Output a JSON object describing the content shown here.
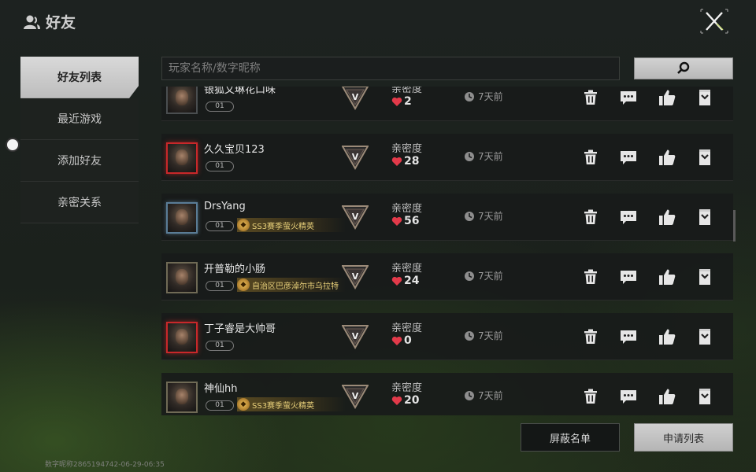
{
  "header": {
    "title": "好友"
  },
  "sidebar": {
    "items": [
      {
        "label": "好友列表",
        "active": true
      },
      {
        "label": "最近游戏",
        "active": false
      },
      {
        "label": "添加好友",
        "active": false
      },
      {
        "label": "亲密关系",
        "active": false
      }
    ]
  },
  "search": {
    "placeholder": "玩家名称/数字昵称",
    "value": ""
  },
  "friends": [
    {
      "name": "银狐文琳花口味",
      "level": "01",
      "title": "",
      "rank": "V",
      "intimacy_label": "亲密度",
      "intimacy": "2",
      "last_seen": "7天前",
      "frame": "dark"
    },
    {
      "name": "久久宝贝123",
      "level": "01",
      "title": "",
      "rank": "V",
      "intimacy_label": "亲密度",
      "intimacy": "28",
      "last_seen": "7天前",
      "frame": "red"
    },
    {
      "name": "DrsYang",
      "level": "01",
      "title": "SS3赛季萤火精英",
      "rank": "V",
      "intimacy_label": "亲密度",
      "intimacy": "56",
      "last_seen": "7天前",
      "frame": "blue"
    },
    {
      "name": "开普勒的小肠",
      "level": "01",
      "title": "自治区巴彦淖尔市乌拉特",
      "rank": "V",
      "intimacy_label": "亲密度",
      "intimacy": "24",
      "last_seen": "7天前",
      "frame": "gold"
    },
    {
      "name": "丁子睿是大帅哥",
      "level": "01",
      "title": "",
      "rank": "V",
      "intimacy_label": "亲密度",
      "intimacy": "0",
      "last_seen": "7天前",
      "frame": "red"
    },
    {
      "name": "神仙hh",
      "level": "01",
      "title": "SS3赛季萤火精英",
      "rank": "V",
      "intimacy_label": "亲密度",
      "intimacy": "20",
      "last_seen": "7天前",
      "frame": "gold"
    }
  ],
  "buttons": {
    "block_list": "屏蔽名单",
    "apply_list": "申请列表"
  },
  "footer": {
    "id_text": "数字昵称2865194742-06-29-06:35"
  },
  "colors": {
    "heart": "#e23a4a",
    "accent_frame_red": "#c8282a",
    "accent_frame_blue": "#5a7c96",
    "title_gold": "#e8d07a"
  },
  "icons": [
    "user-icon",
    "close-icon",
    "search-icon",
    "trash-icon",
    "chat-icon",
    "thumbs-up-icon",
    "card-icon",
    "clock-icon",
    "heart-icon",
    "rank-v-icon"
  ]
}
